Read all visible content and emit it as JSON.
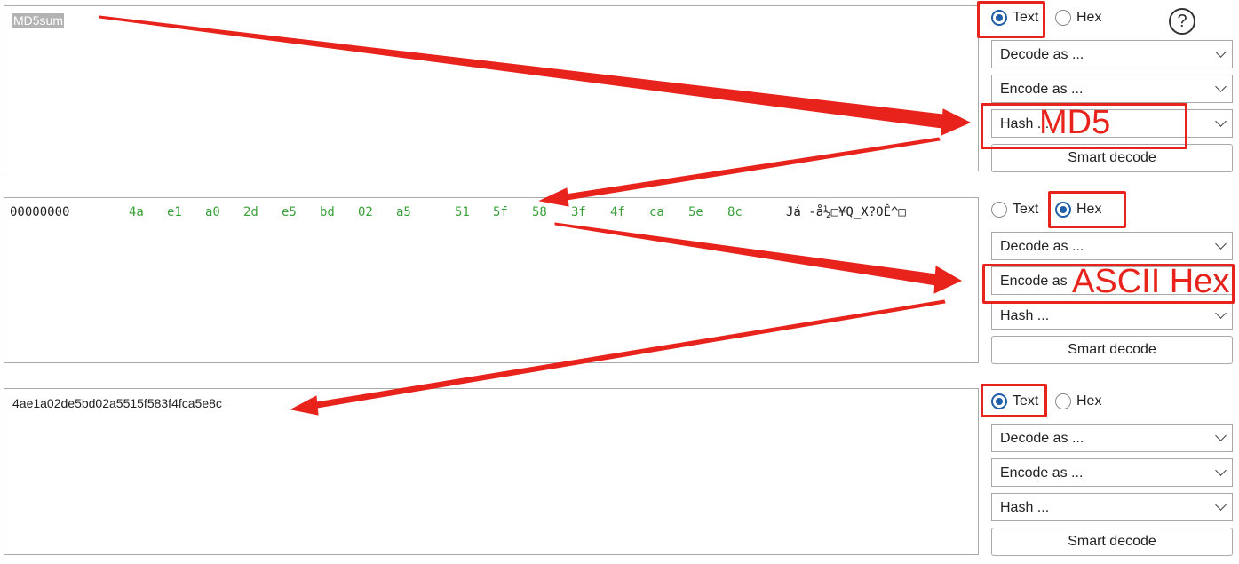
{
  "panels": [
    {
      "text": "MD5sum",
      "controls": {
        "radio_text": "Text",
        "radio_hex": "Hex",
        "selected": "Text",
        "help": "?",
        "decode_label": "Decode as ...",
        "encode_label": "Encode as ...",
        "hash_label": "Hash ...",
        "smart_label": "Smart decode"
      }
    },
    {
      "hex": {
        "offset": "00000000",
        "bytes": [
          "4a",
          "e1",
          "a0",
          "2d",
          "e5",
          "bd",
          "02",
          "a5",
          "51",
          "5f",
          "58",
          "3f",
          "4f",
          "ca",
          "5e",
          "8c"
        ],
        "ascii": "Já -å½□¥Q_X?OÊ^□"
      },
      "controls": {
        "radio_text": "Text",
        "radio_hex": "Hex",
        "selected": "Hex",
        "decode_label": "Decode as ...",
        "encode_label": "Encode as",
        "hash_label": "Hash ...",
        "smart_label": "Smart decode"
      }
    },
    {
      "text": "4ae1a02de5bd02a5515f583f4fca5e8c",
      "controls": {
        "radio_text": "Text",
        "radio_hex": "Hex",
        "selected": "Text",
        "decode_label": "Decode as ...",
        "encode_label": "Encode as ...",
        "hash_label": "Hash ...",
        "smart_label": "Smart decode"
      }
    }
  ],
  "annotations": {
    "hash_overlay": "MD5",
    "encode_overlay": "ASCII Hex",
    "color": "#e8231c"
  }
}
